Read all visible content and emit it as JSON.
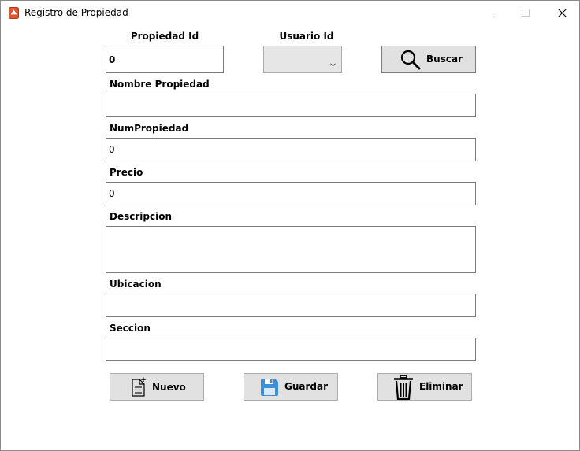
{
  "window": {
    "title": "Registro de Propiedad",
    "minimize_icon": "minimize-icon",
    "maximize_icon": "maximize-icon",
    "close_icon": "close-icon",
    "app_icon": "app-document-icon",
    "app_icon_color": "#e0542c"
  },
  "form": {
    "propiedad_id": {
      "label": "Propiedad Id",
      "value": "0"
    },
    "usuario_id": {
      "label": "Usuario Id",
      "value": ""
    },
    "nombre": {
      "label": "Nombre Propiedad",
      "value": ""
    },
    "num": {
      "label": "NumPropiedad",
      "value": "0"
    },
    "precio": {
      "label": "Precio",
      "value": "0"
    },
    "descripcion": {
      "label": "Descripcion",
      "value": ""
    },
    "ubicacion": {
      "label": "Ubicacion",
      "value": ""
    },
    "seccion": {
      "label": "Seccion",
      "value": ""
    }
  },
  "buttons": {
    "buscar": {
      "label": "Buscar",
      "icon": "search-icon"
    },
    "nuevo": {
      "label": "Nuevo",
      "icon": "new-document-icon"
    },
    "guardar": {
      "label": "Guardar",
      "icon": "save-icon",
      "icon_color": "#3d8fd6"
    },
    "eliminar": {
      "label": "Eliminar",
      "icon": "trash-icon"
    }
  }
}
